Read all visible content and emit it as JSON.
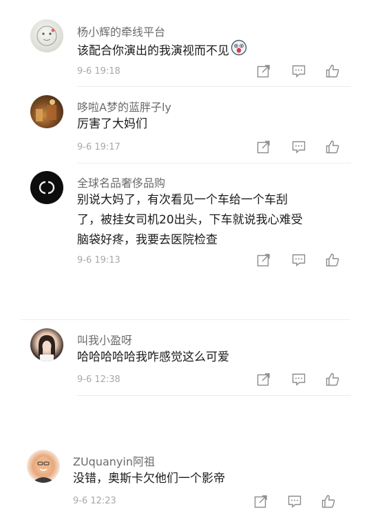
{
  "colors": {
    "name": "#6b6b6b",
    "text": "#1a1a1a",
    "time": "#a8a8a8",
    "icon": "#8a8a8a"
  },
  "comments": [
    {
      "name": "杨小辉的牵线平台",
      "lines": [
        "该配合你演出的我演视而不见"
      ],
      "emoji": "shocked-face-emoji",
      "time": "9-6 19:18",
      "avatar": "doodle-avatar"
    },
    {
      "name": "哆啦A梦的蓝胖子ly",
      "lines": [
        "厉害了大妈们"
      ],
      "time": "9-6 19:17",
      "avatar": "photo-avatar"
    },
    {
      "name": "全球名品奢侈品购",
      "lines": [
        "别说大妈了，有次看见一个车给一个车刮",
        "了，被挂女司机20出头，下车就说我心难受",
        "脑袋好疼，我要去医院检查"
      ],
      "time": "9-6 19:13",
      "avatar": "chanel-logo-avatar"
    },
    {
      "name": "叫我小盈呀",
      "lines": [
        "哈哈哈哈哈我咋感觉这么可爱"
      ],
      "time": "9-6 12:38",
      "avatar": "girl-avatar"
    },
    {
      "name": "ZUquanyin阿祖",
      "lines": [
        "没错，奥斯卡欠他们一个影帝"
      ],
      "time": "9-6 12:23",
      "avatar": "man-avatar"
    }
  ],
  "actions": [
    "share-icon",
    "comment-icon",
    "like-icon"
  ]
}
